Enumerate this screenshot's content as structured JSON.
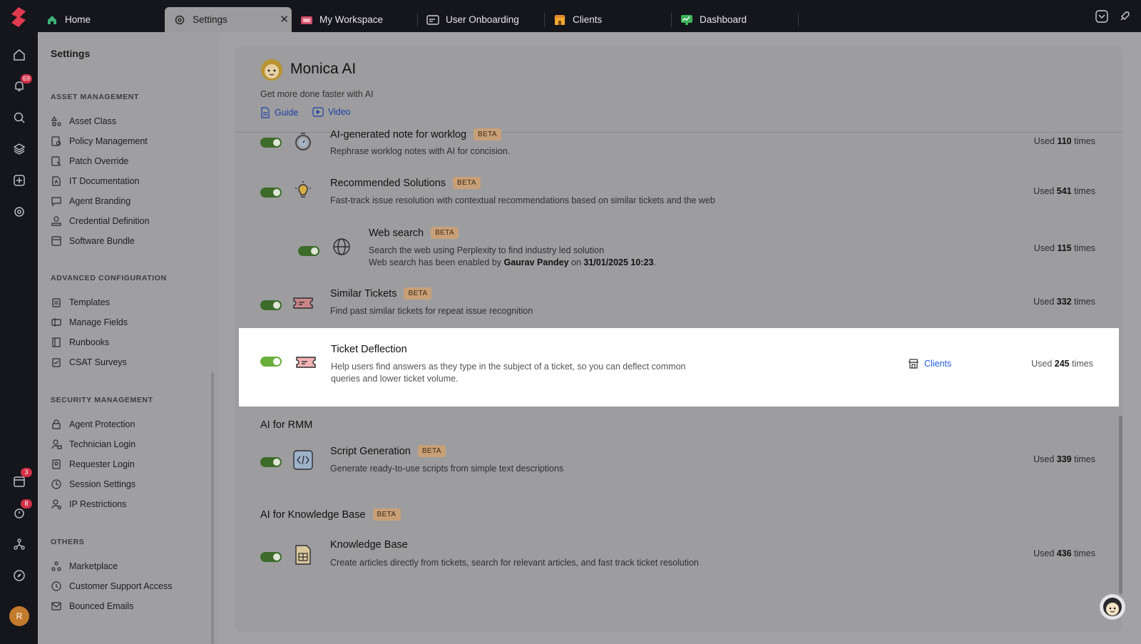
{
  "tabs": [
    {
      "label": "Home",
      "icon": "home-icon"
    },
    {
      "label": "Settings",
      "icon": "gear-icon"
    },
    {
      "label": "My Workspace",
      "icon": "workspace-icon"
    },
    {
      "label": "User Onboarding",
      "icon": "onboarding-icon"
    },
    {
      "label": "Clients",
      "icon": "clients-icon"
    },
    {
      "label": "Dashboard",
      "icon": "dashboard-icon"
    }
  ],
  "rail": {
    "notifications_badge": "69",
    "calendar_badge": "3",
    "timer_badge": "8",
    "avatar_initial": "R"
  },
  "sidebar": {
    "title": "Settings",
    "sections": [
      {
        "title": "ASSET MANAGEMENT",
        "items": [
          "Asset Class",
          "Policy Management",
          "Patch Override",
          "IT Documentation",
          "Agent Branding",
          "Credential Definition",
          "Software Bundle"
        ]
      },
      {
        "title": "ADVANCED CONFIGURATION",
        "items": [
          "Templates",
          "Manage Fields",
          "Runbooks",
          "CSAT Surveys"
        ]
      },
      {
        "title": "SECURITY MANAGEMENT",
        "items": [
          "Agent Protection",
          "Technician Login",
          "Requester Login",
          "Session Settings",
          "IP Restrictions"
        ]
      },
      {
        "title": "OTHERS",
        "items": [
          "Marketplace",
          "Customer Support Access",
          "Bounced Emails"
        ]
      }
    ]
  },
  "panel": {
    "title": "Monica AI",
    "subtitle": "Get more done faster with AI",
    "guide_label": "Guide",
    "video_label": "Video"
  },
  "features": {
    "worklog": {
      "title": "AI-generated note for worklog",
      "badge": "BETA",
      "desc": "Rephrase worklog notes with AI for concision.",
      "used_prefix": "Used",
      "used_count": "110",
      "used_suffix": "times"
    },
    "recommended": {
      "title": "Recommended Solutions",
      "badge": "BETA",
      "desc": "Fast-track issue resolution with contextual recommendations based on similar tickets and the web",
      "used_prefix": "Used",
      "used_count": "541",
      "used_suffix": "times"
    },
    "websearch": {
      "title": "Web search",
      "badge": "BETA",
      "desc": "Search the web using Perplexity to find industry led solution",
      "enabled_prefix": "Web search has been enabled by",
      "enabled_by": "Gaurav Pandey",
      "enabled_on": "on",
      "enabled_date": "31/01/2025 10:23",
      "enabled_end": ".",
      "used_prefix": "Used",
      "used_count": "115",
      "used_suffix": "times"
    },
    "similar": {
      "title": "Similar Tickets",
      "badge": "BETA",
      "desc": "Find past similar tickets for repeat issue recognition",
      "used_prefix": "Used",
      "used_count": "332",
      "used_suffix": "times"
    },
    "deflection": {
      "title": "Ticket Deflection",
      "desc": "Help users find answers as they type in the subject of a ticket, so you can deflect common queries and lower ticket volume.",
      "clients_label": "Clients",
      "used_prefix": "Used",
      "used_count": "245",
      "used_suffix": "times"
    },
    "rmm_section": "AI for RMM",
    "script": {
      "title": "Script Generation",
      "badge": "BETA",
      "desc": "Generate ready-to-use scripts from simple text descriptions",
      "used_prefix": "Used",
      "used_count": "339",
      "used_suffix": "times"
    },
    "kb_section": "AI for Knowledge Base",
    "kb_section_badge": "BETA",
    "kb": {
      "title": "Knowledge Base",
      "desc": "Create articles directly from tickets, search for relevant articles, and fast track ticket resolution",
      "used_prefix": "Used",
      "used_count": "436",
      "used_suffix": "times"
    }
  }
}
